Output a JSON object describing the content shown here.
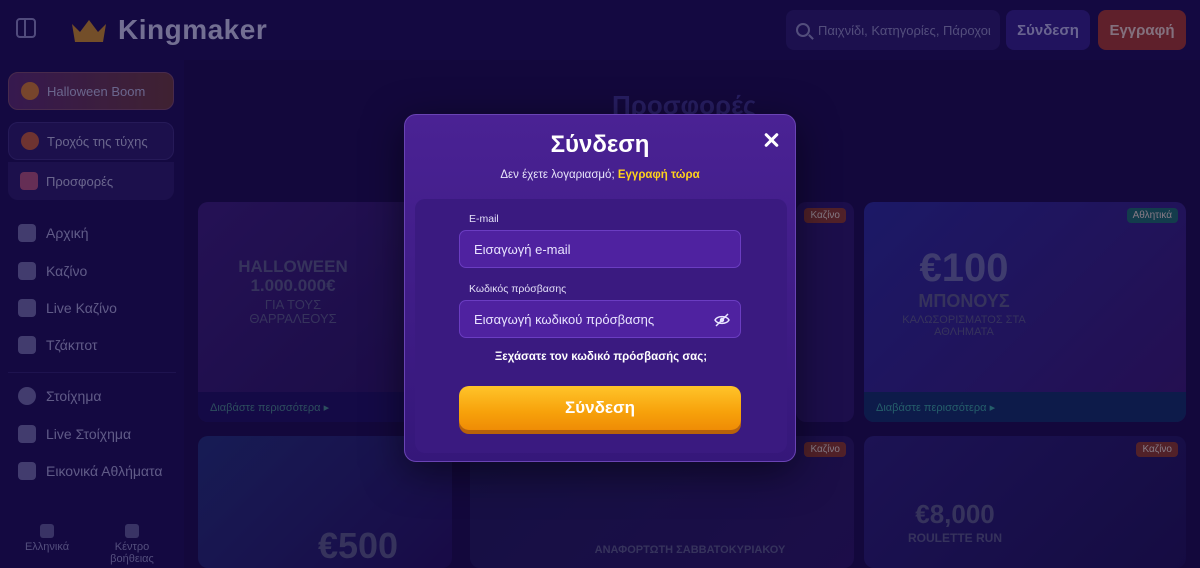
{
  "header": {
    "brand": "Kingmaker",
    "search_placeholder": "Παιχνίδι, Κατηγορίες, Πάροχοι",
    "login_label": "Σύνδεση",
    "register_label": "Εγγραφή"
  },
  "sidebar": {
    "promos": [
      {
        "label": "Halloween Boom"
      },
      {
        "label": "Τροχός της τύχης"
      },
      {
        "label": "Προσφορές"
      }
    ],
    "items": [
      {
        "label": "Αρχική"
      },
      {
        "label": "Καζίνο"
      },
      {
        "label": "Live Καζίνο"
      },
      {
        "label": "Τζάκποτ"
      },
      {
        "label": "Στοίχημα"
      },
      {
        "label": "Live Στοίχημα"
      },
      {
        "label": "Εικονικά Αθλήματα"
      }
    ],
    "bottom": {
      "language": "Ελληνικά",
      "help": "Κέντρο βοήθειας"
    }
  },
  "main": {
    "title": "Προσφορές",
    "cards": [
      {
        "headline": "HALLOWEEN 1.000.000€",
        "sub": "ΓΙΑ ΤΟΥΣ ΘΑΡΡΑΛΕΟΥΣ",
        "link": "Διαβάστε περισσότερα ▸"
      },
      {
        "tag": "Καζίνο"
      },
      {
        "tag": "Αθλητικά",
        "headline": "€100",
        "sub": "ΜΠΟΝΟΥΣ",
        "sub2": "ΚΑΛΩΣΟΡΙΣΜΑΤΟΣ ΣΤΑ ΑΘΛΗΜΑΤΑ",
        "link": "Διαβάστε περισσότερα ▸"
      },
      {
        "headline": "€500"
      },
      {
        "tag": "Καζίνο",
        "sub": "ΑΝΑΦΟΡΤΩΤΗ ΣΑΒΒΑΤΟΚΥΡΙΑΚΟΥ"
      },
      {
        "tag": "Καζίνο",
        "headline": "€8,000",
        "sub": "ROULETTE RUN"
      }
    ]
  },
  "modal": {
    "title": "Σύνδεση",
    "subtitle_text": "Δεν έχετε λογαριασμό; ",
    "subtitle_link": "Εγγραφή τώρα",
    "email_label": "E-mail",
    "email_placeholder": "Εισαγωγή e-mail",
    "password_label": "Κωδικός πρόσβασης",
    "password_placeholder": "Εισαγωγή κωδικού πρόσβασης",
    "forgot_label": "Ξεχάσατε τον κωδικό πρόσβασής σας;",
    "submit_label": "Σύνδεση"
  },
  "colors": {
    "page_bg": "#1a0c4d",
    "modal_bg": "#4a2294",
    "accent_link": "#ffd21a",
    "button_gradient_top": "#ffc42a",
    "button_gradient_bottom": "#ef8c05"
  },
  "icons": [
    "sidebar-toggle-icon",
    "crown-icon",
    "search-icon",
    "close-icon",
    "eye-off-icon"
  ]
}
